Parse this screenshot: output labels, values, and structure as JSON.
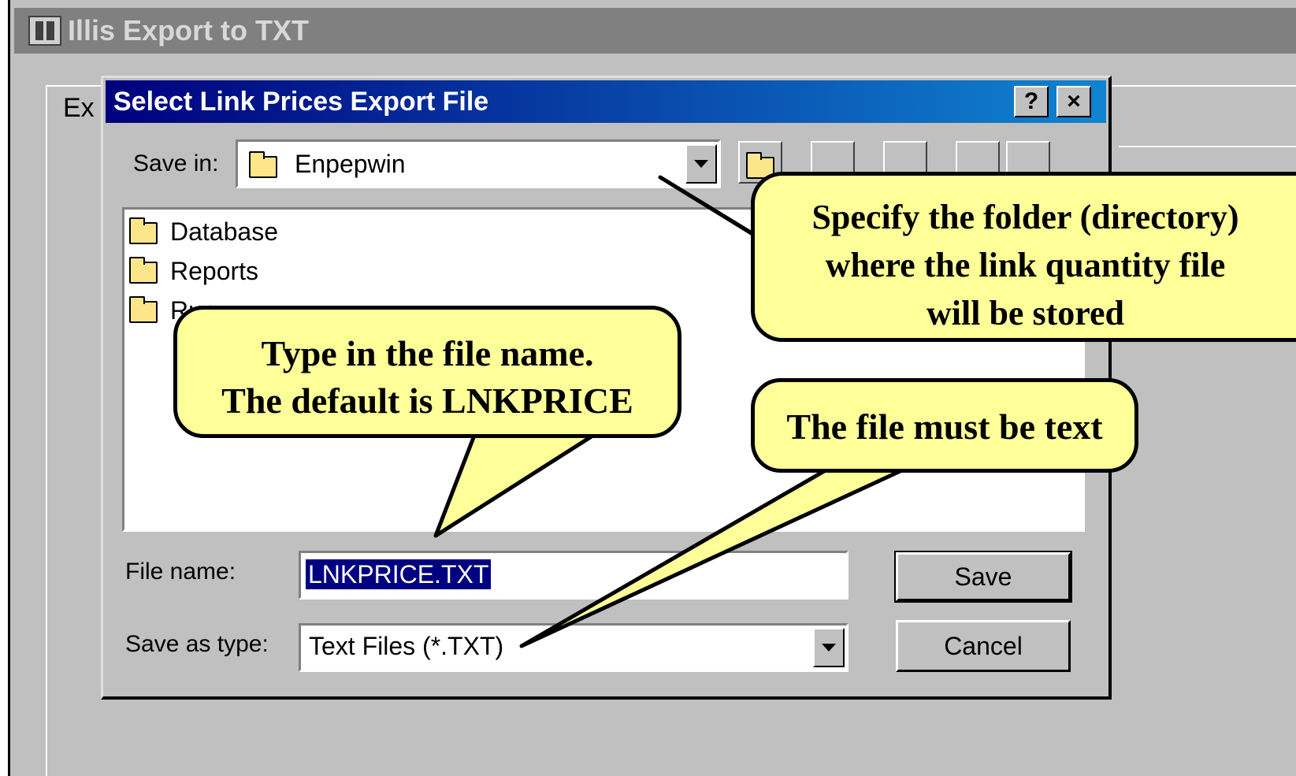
{
  "outer_window": {
    "title": "Illis Export to TXT",
    "tab_label": "Ex"
  },
  "dialog": {
    "title": "Select Link Prices Export File",
    "help_button": "?",
    "close_button": "×",
    "save_in_label": "Save in:",
    "save_in_value": "Enpepwin",
    "files": [
      {
        "name": "Database"
      },
      {
        "name": "Reports"
      },
      {
        "name": "Run"
      }
    ],
    "file_name_label": "File name:",
    "file_name_value": "LNKPRICE.TXT",
    "save_as_type_label": "Save as type:",
    "save_as_type_value": "Text Files (*.TXT)",
    "save_button": "Save",
    "cancel_button": "Cancel"
  },
  "callouts": {
    "folder": "Specify the folder (directory)\nwhere the link quantity file\nwill be stored",
    "filename": "Type in the file name.\nThe default is LNKPRICE",
    "filetype": "The file must be text"
  },
  "colors": {
    "callout_fill": "#ffff99",
    "title_gradient_start": "#00007e",
    "title_gradient_end": "#1084d0",
    "window_face": "#c0c0c0"
  }
}
